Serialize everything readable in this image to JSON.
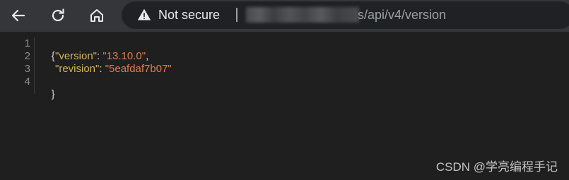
{
  "browser": {
    "security_label": "Not secure",
    "url_path": "s/api/v4/version",
    "icons": {
      "back": "back-arrow-icon",
      "reload": "reload-icon",
      "home": "home-icon",
      "warning": "warning-triangle-icon"
    }
  },
  "editor": {
    "line_numbers": [
      "1",
      "2",
      "3",
      "4"
    ],
    "lines": {
      "open_brace": "{",
      "version_key": "\"version\"",
      "version_colon": ": ",
      "version_value": "\"13.10.0\"",
      "version_comma": ",",
      "revision_key": "\"revision\"",
      "revision_colon": ": ",
      "revision_value": "\"5eafdaf7b07\"",
      "close_brace": "}"
    }
  },
  "watermark": "CSDN @学亮编程手记",
  "colors": {
    "toolbar": "#35363a",
    "page_bg": "#1f1f1f",
    "json_key": "#d4b35a",
    "json_string": "#e07b4f"
  }
}
